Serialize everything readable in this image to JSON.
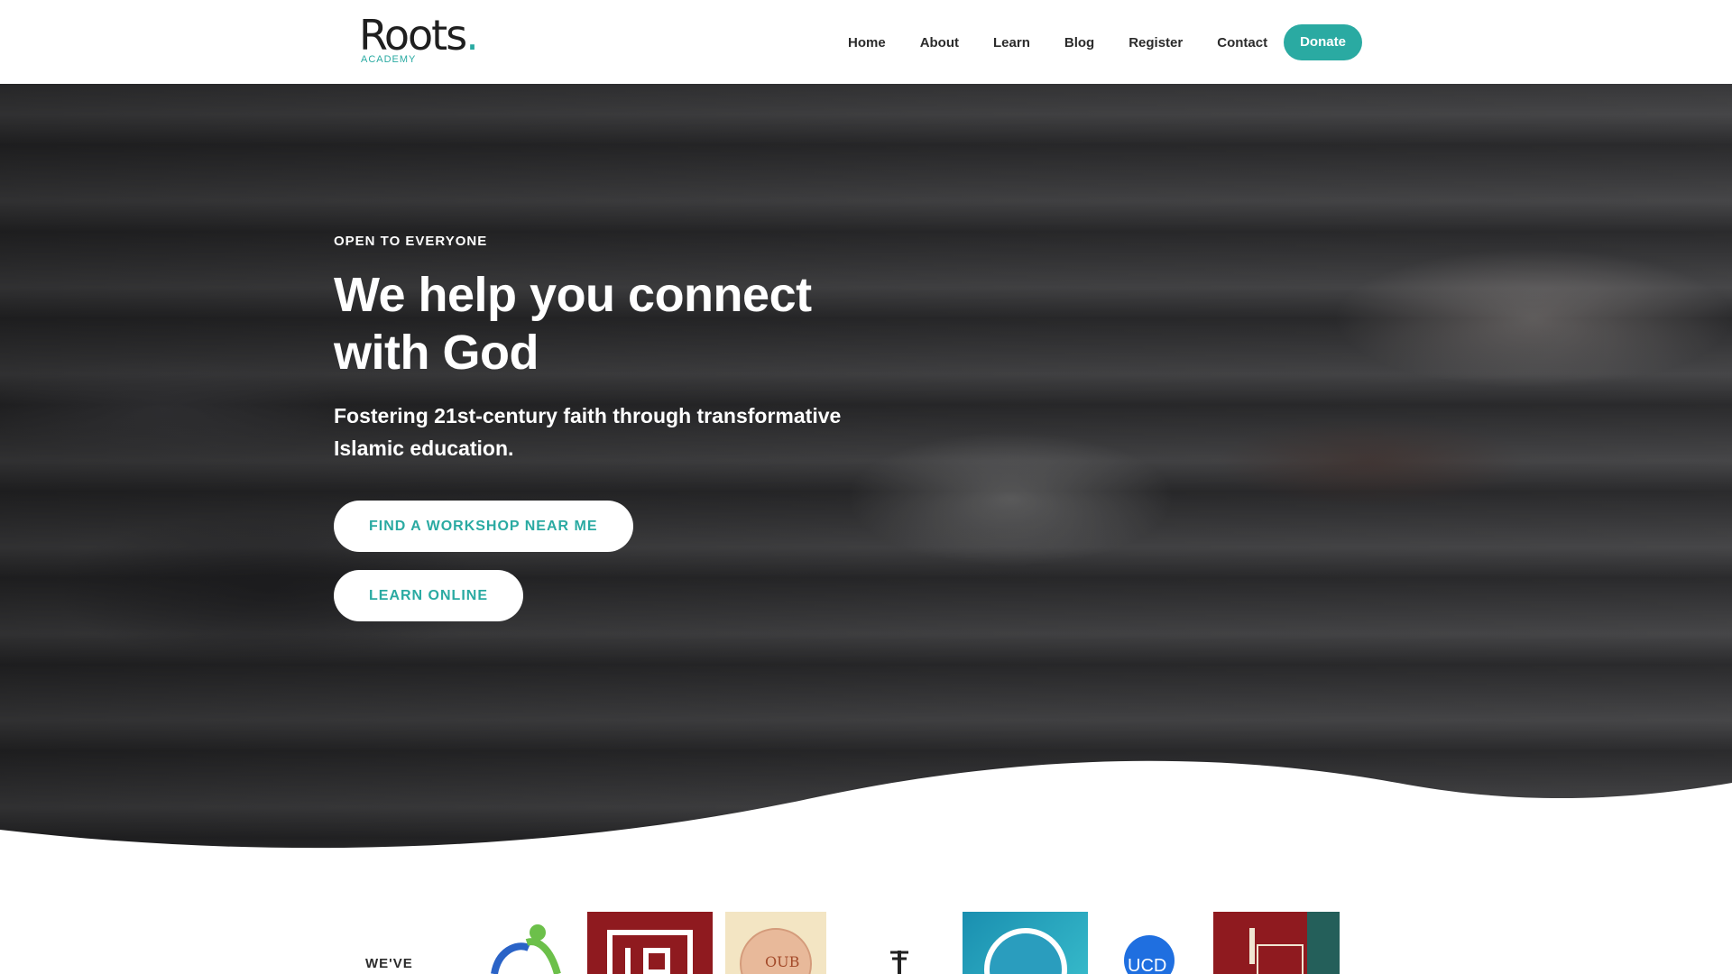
{
  "brand": {
    "name": "Roots",
    "dot": ".",
    "sub": "ACADEMY",
    "accent": "#2aaaa2"
  },
  "nav": {
    "items": [
      {
        "label": "Home"
      },
      {
        "label": "About"
      },
      {
        "label": "Learn"
      },
      {
        "label": "Blog"
      },
      {
        "label": "Register"
      },
      {
        "label": "Contact"
      }
    ],
    "donate_label": "Donate"
  },
  "hero": {
    "eyebrow": "OPEN TO EVERYONE",
    "headline": "We help you connect with God",
    "subheading": "Fostering 21st-century faith through transformative Islamic education.",
    "button_primary": "FIND A WORKSHOP NEAR ME",
    "button_secondary": "LEARN ONLINE",
    "image": "lecture-hall-students-photo"
  },
  "partners": {
    "label": "WE'VE",
    "logos": [
      {
        "icon": "partner-logo-green-figure"
      },
      {
        "icon": "partner-logo-isoc-red"
      },
      {
        "icon": "partner-logo-oub-seal",
        "text": "OUB"
      },
      {
        "icon": "partner-logo-caduceus"
      },
      {
        "icon": "partner-logo-blue-mosaic"
      },
      {
        "icon": "partner-logo-ucd-dome",
        "text": "UCD"
      },
      {
        "icon": "partner-logo-red-minaret"
      }
    ]
  }
}
